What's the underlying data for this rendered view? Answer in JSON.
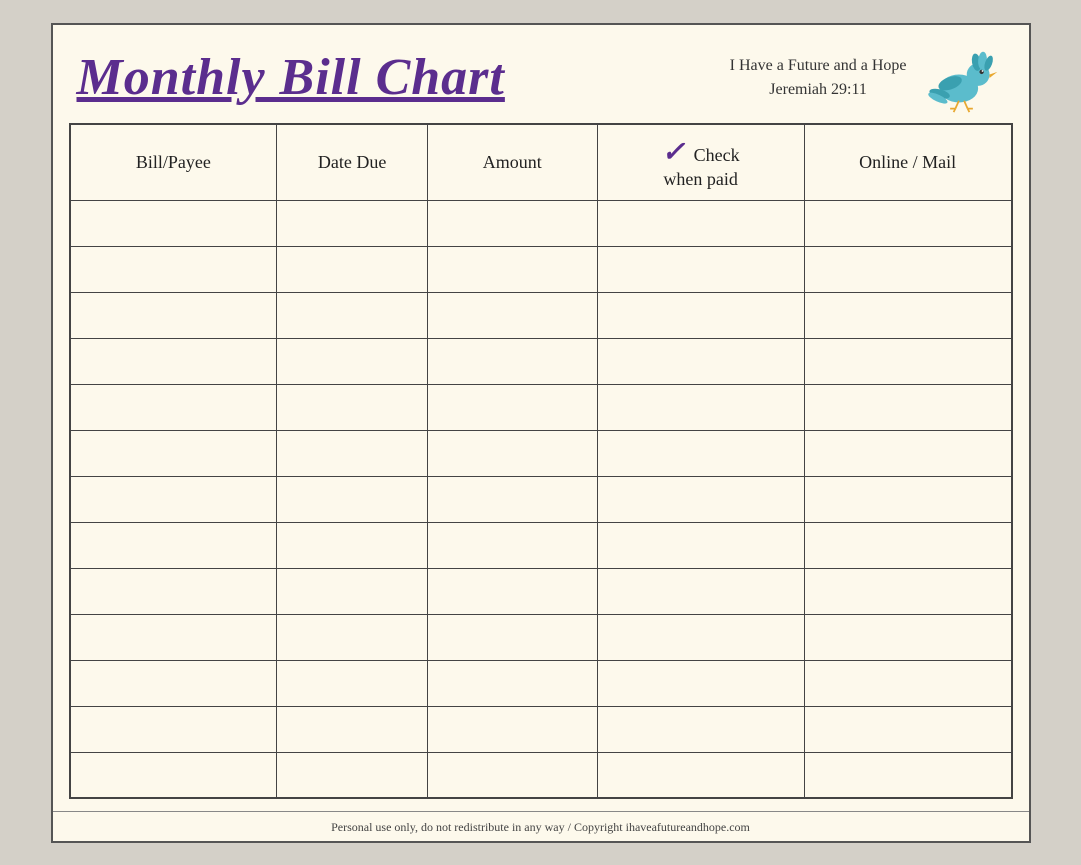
{
  "header": {
    "title": "Monthly Bill Chart",
    "tagline_line1": "I Have a Future and a Hope",
    "tagline_line2": "Jeremiah 29:11"
  },
  "table": {
    "columns": [
      {
        "key": "bill",
        "label": "Bill/Payee",
        "class": "col-bill"
      },
      {
        "key": "date",
        "label": "Date Due",
        "class": "col-date"
      },
      {
        "key": "amount",
        "label": "Amount",
        "class": "col-amount"
      },
      {
        "key": "check",
        "label": "when paid",
        "class": "col-check",
        "has_check": true
      },
      {
        "key": "online",
        "label": "Online / Mail",
        "class": "col-online"
      }
    ],
    "row_count": 13
  },
  "footer": {
    "text": "Personal use only, do not redistribute in any way / Copyright ihaveafutureandhope.com"
  }
}
